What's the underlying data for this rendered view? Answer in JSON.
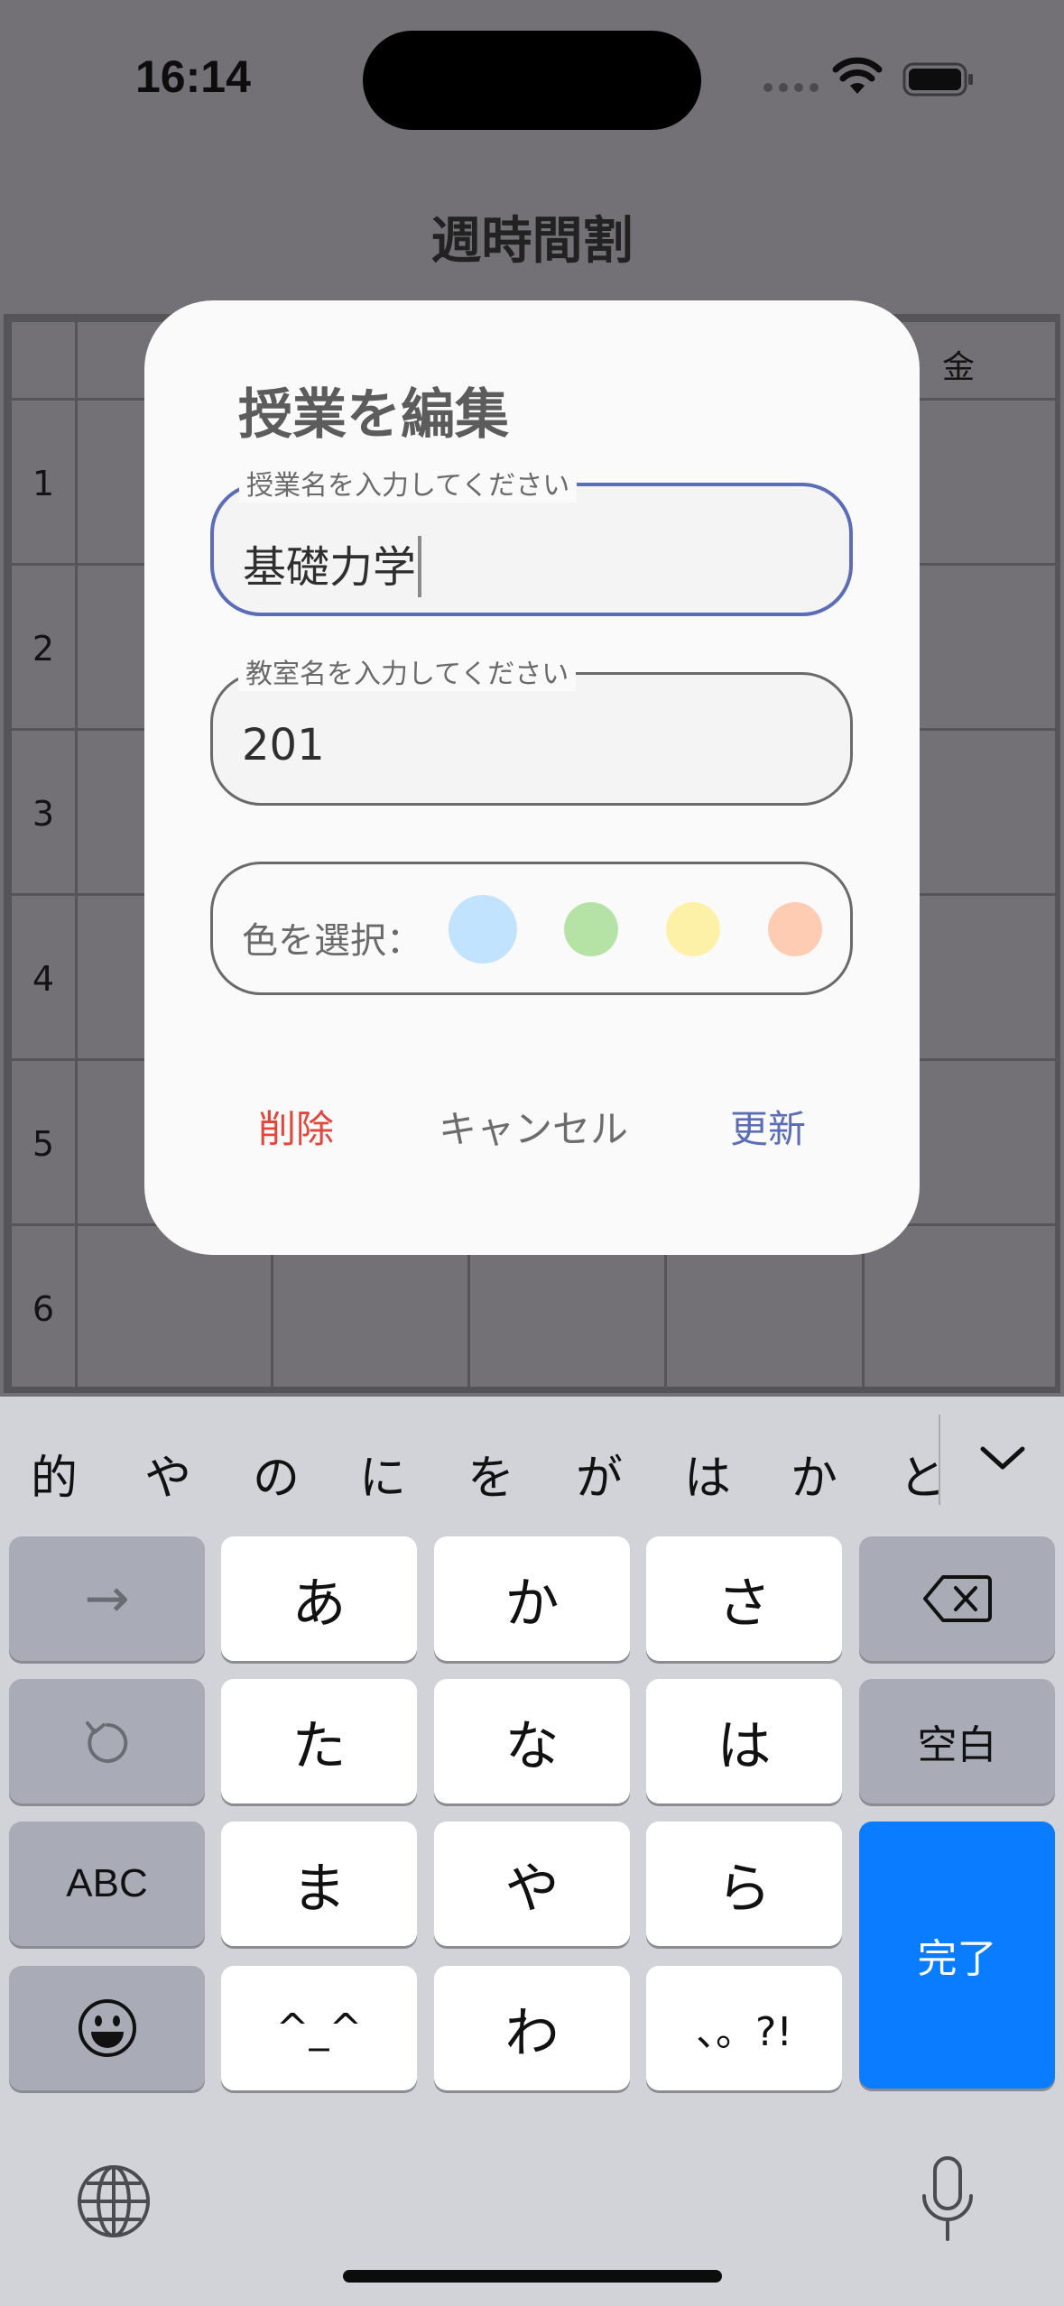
{
  "status_bar": {
    "time": "16:14"
  },
  "app": {
    "title": "週時間割",
    "days": [
      "金"
    ],
    "periods": [
      "1",
      "2",
      "3",
      "4",
      "5",
      "6"
    ]
  },
  "dialog": {
    "title": "授業を編集",
    "course_field": {
      "label": "授業名を入力してください",
      "value": "基礎力学"
    },
    "room_field": {
      "label": "教室名を入力してください",
      "value": "201"
    },
    "color_picker": {
      "label": "色を選択：",
      "options": [
        {
          "name": "blue",
          "color": "#c2e3fd"
        },
        {
          "name": "green",
          "color": "#b5e3a6"
        },
        {
          "name": "yellow",
          "color": "#fdf0a7"
        },
        {
          "name": "orange",
          "color": "#fdccb3"
        }
      ]
    },
    "actions": {
      "delete": "削除",
      "cancel": "キャンセル",
      "update": "更新"
    },
    "colors": {
      "delete": "#e1473d",
      "cancel": "#6c6c6c",
      "update": "#5b6db7"
    }
  },
  "keyboard": {
    "candidates": [
      "的",
      "や",
      "の",
      "に",
      "を",
      "が",
      "は",
      "か",
      "と"
    ],
    "keys": {
      "next": "→",
      "a": "あ",
      "ka": "か",
      "sa": "さ",
      "ta": "た",
      "na": "な",
      "ha": "は",
      "space": "空白",
      "abc": "ABC",
      "ma": "ま",
      "ya": "や",
      "ra": "ら",
      "done": "完了",
      "kaomoji": "^_^",
      "wa": "わ",
      "punct": "、。?!"
    },
    "colors": {
      "done": "#0a7cff"
    }
  }
}
